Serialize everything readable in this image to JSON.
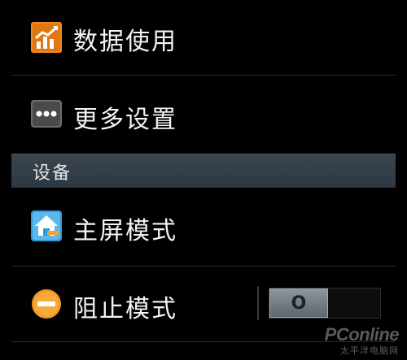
{
  "settings": {
    "rows": [
      {
        "label": "数据使用",
        "icon": "data-usage-chart-icon"
      },
      {
        "label": "更多设置",
        "icon": "more-dots-icon"
      }
    ],
    "section_header": "设备",
    "device_rows": [
      {
        "label": "主屏模式",
        "icon": "home-screen-icon"
      },
      {
        "label": "阻止模式",
        "icon": "block-mode-icon",
        "toggle_state": "off",
        "toggle_knob_label": "O"
      }
    ]
  },
  "watermark": {
    "brand": "PConline",
    "sub": "太平洋电脑网"
  },
  "colors": {
    "background": "#000000",
    "section_header_bg": "#34404a",
    "data_icon_orange": "#f08a1e",
    "block_icon_orange": "#f29a2a",
    "home_icon_blue": "#2f9bd9"
  }
}
